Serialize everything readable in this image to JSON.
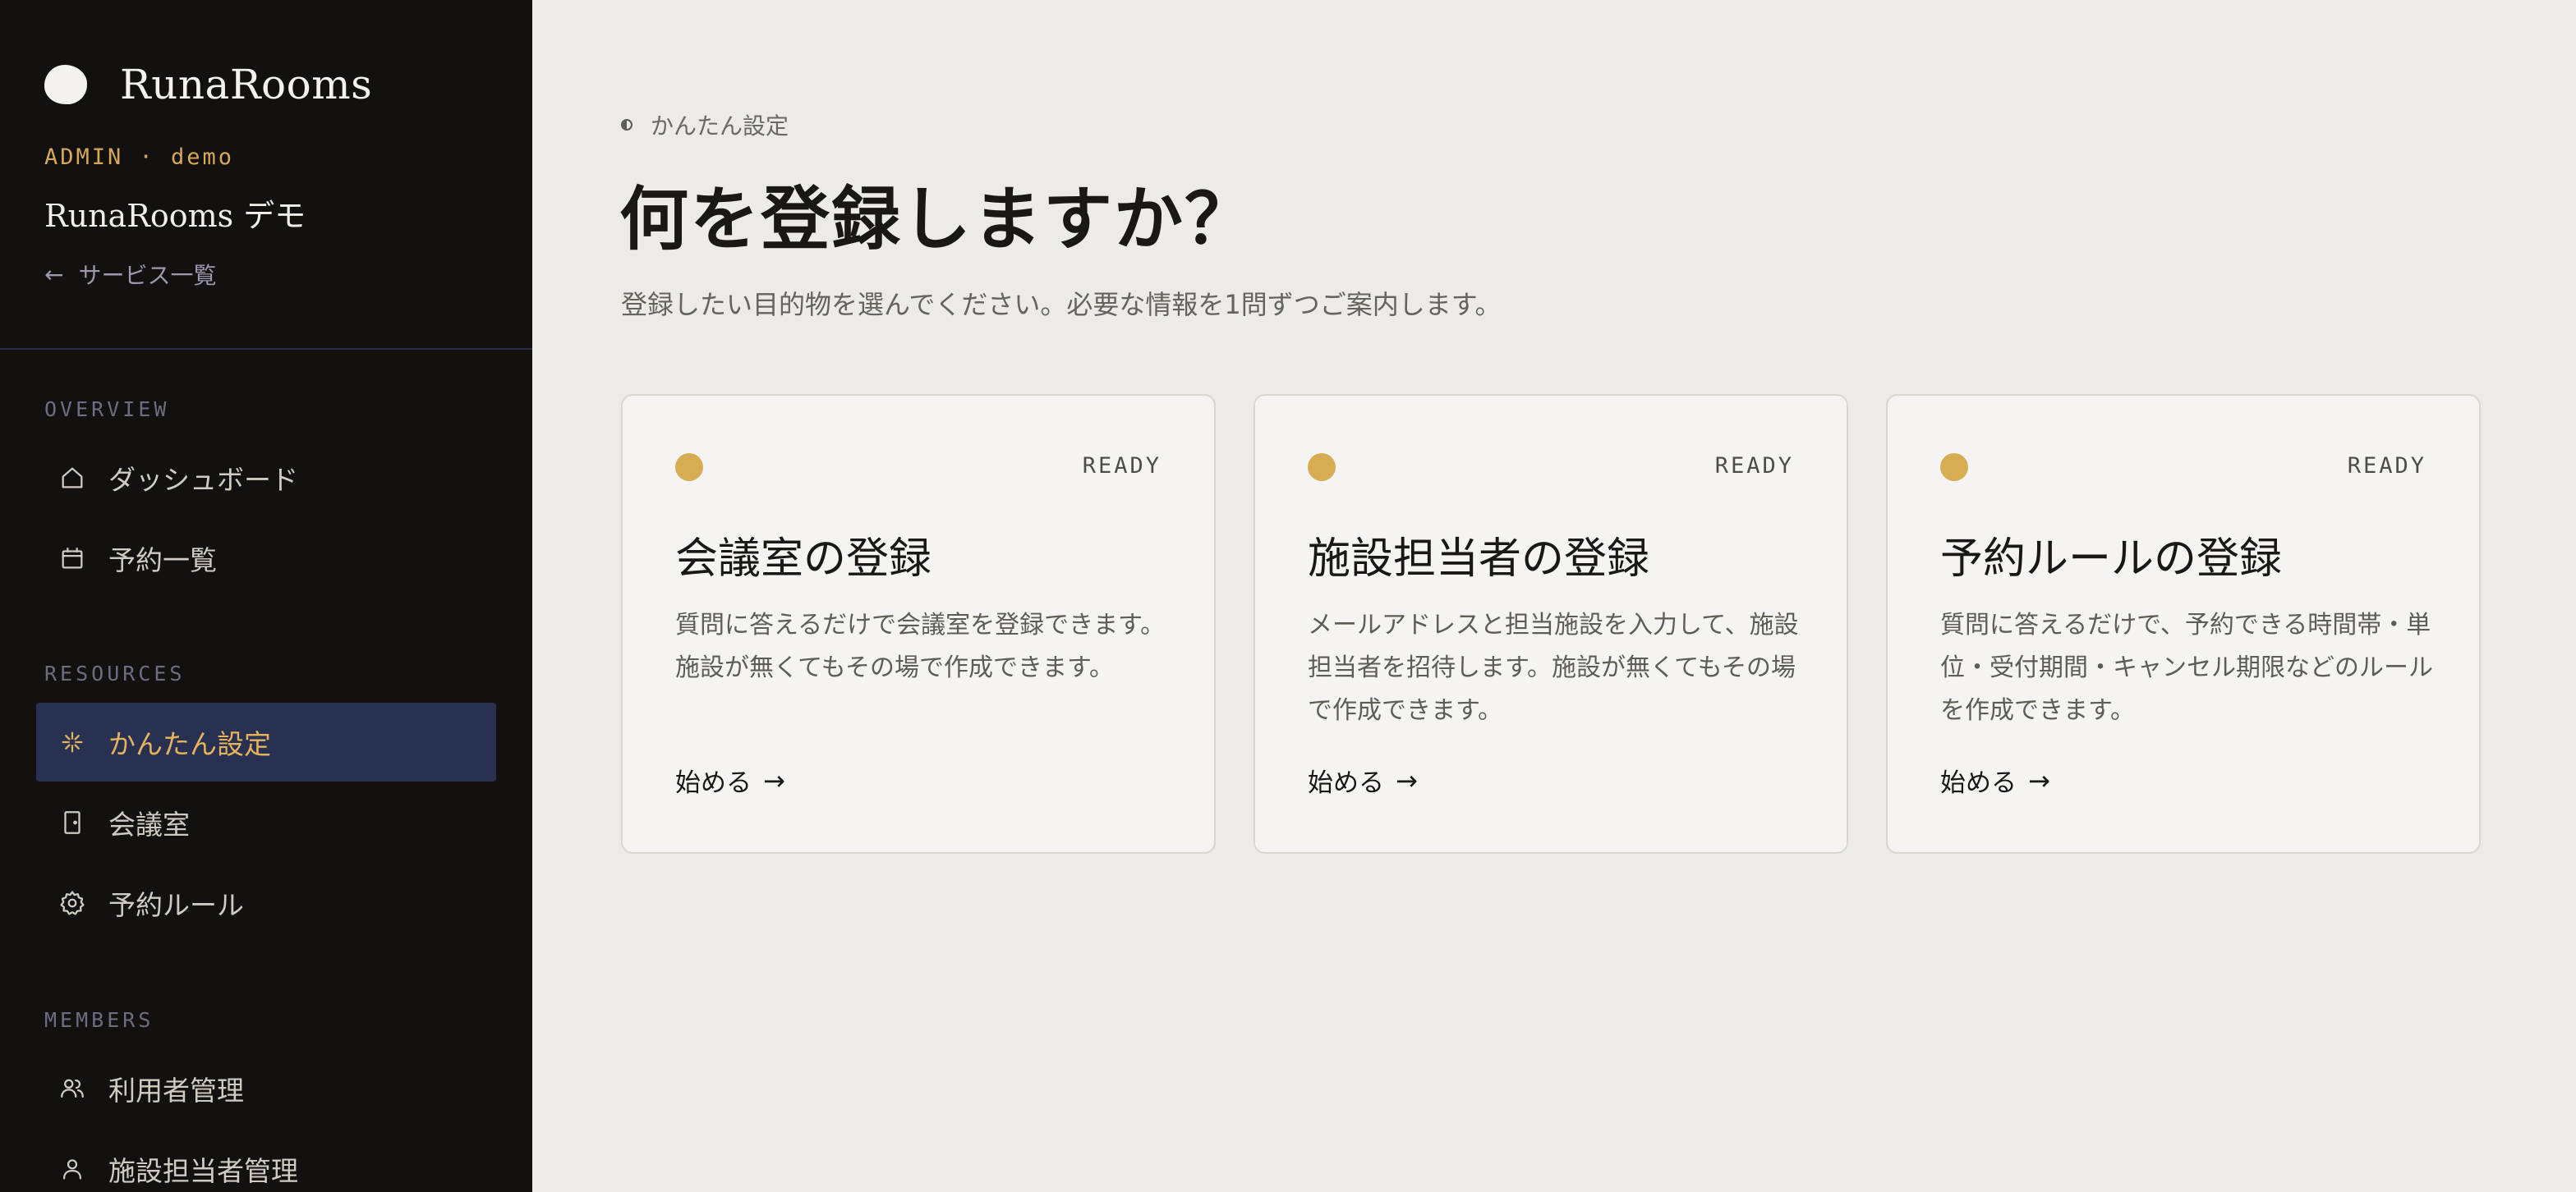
{
  "brand": {
    "name": "RunaRooms",
    "admin_label": "ADMIN · demo",
    "org_name": "RunaRooms デモ",
    "back_link": "サービス一覧",
    "back_arrow": "←"
  },
  "sidebar": {
    "sections": [
      {
        "label": "OVERVIEW",
        "items": [
          {
            "label": "ダッシュボード",
            "icon": "home-icon"
          },
          {
            "label": "予約一覧",
            "icon": "calendar-icon"
          }
        ]
      },
      {
        "label": "RESOURCES",
        "items": [
          {
            "label": "かんたん設定",
            "icon": "sparkle-icon",
            "active": true
          },
          {
            "label": "会議室",
            "icon": "door-icon"
          },
          {
            "label": "予約ルール",
            "icon": "gear-icon"
          }
        ]
      },
      {
        "label": "MEMBERS",
        "items": [
          {
            "label": "利用者管理",
            "icon": "users-icon"
          },
          {
            "label": "施設担当者管理",
            "icon": "user-icon"
          }
        ]
      }
    ]
  },
  "main": {
    "breadcrumb": "かんたん設定",
    "title": "何を登録しますか？",
    "description": "登録したい目的物を選んでください。必要な情報を1問ずつご案内します。",
    "cards": [
      {
        "status": "READY",
        "title": "会議室の登録",
        "description": "質問に答えるだけで会議室を登録できます。施設が無くてもその場で作成できます。",
        "action": "始める",
        "action_arrow": "→"
      },
      {
        "status": "READY",
        "title": "施設担当者の登録",
        "description": "メールアドレスと担当施設を入力して、施設担当者を招待します。施設が無くてもその場で作成できます。",
        "action": "始める",
        "action_arrow": "→"
      },
      {
        "status": "READY",
        "title": "予約ルールの登録",
        "description": "質問に答えるだけで、予約できる時間帯・単位・受付期間・キャンセル期限などのルールを作成できます。",
        "action": "始める",
        "action_arrow": "→"
      }
    ]
  },
  "colors": {
    "sidebar_bg": "#13110f",
    "active_bg": "#283151",
    "accent": "#d6a85a",
    "status_dot": "#d6ad52",
    "main_bg": "#edebe7"
  }
}
